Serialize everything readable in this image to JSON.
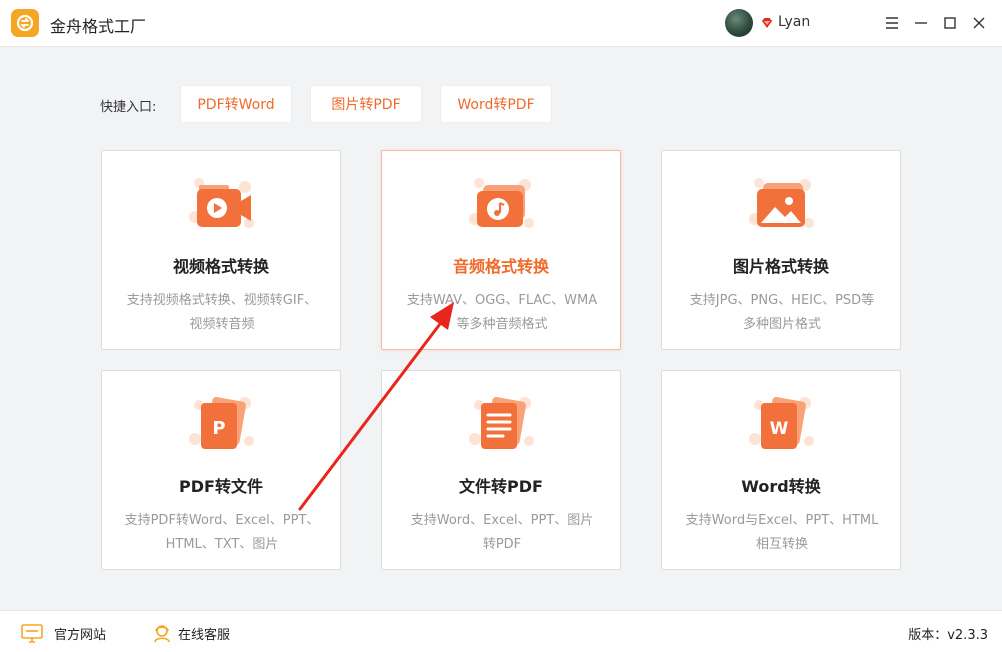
{
  "app": {
    "title": "金舟格式工厂"
  },
  "user": {
    "name": "Lyan"
  },
  "shortcuts": {
    "label": "快捷入口:",
    "items": [
      {
        "label": "PDF转Word"
      },
      {
        "label": "图片转PDF"
      },
      {
        "label": "Word转PDF"
      }
    ]
  },
  "cards": [
    {
      "title": "视频格式转换",
      "desc_line1": "支持视频格式转换、视频转GIF、",
      "desc_line2": "视频转音频",
      "icon": "video-icon"
    },
    {
      "title": "音频格式转换",
      "desc_line1": "支持WAV、OGG、FLAC、WMA",
      "desc_line2": "等多种音频格式",
      "icon": "audio-icon",
      "active": true
    },
    {
      "title": "图片格式转换",
      "desc_line1": "支持JPG、PNG、HEIC、PSD等",
      "desc_line2": "多种图片格式",
      "icon": "image-icon"
    },
    {
      "title": "PDF转文件",
      "desc_line1": "支持PDF转Word、Excel、PPT、",
      "desc_line2": "HTML、TXT、图片",
      "icon": "pdf-icon"
    },
    {
      "title": "文件转PDF",
      "desc_line1": "支持Word、Excel、PPT、图片",
      "desc_line2": "转PDF",
      "icon": "document-icon"
    },
    {
      "title": "Word转换",
      "desc_line1": "支持Word与Excel、PPT、HTML",
      "desc_line2": "相互转换",
      "icon": "word-icon"
    }
  ],
  "footer": {
    "website": "官方网站",
    "support": "在线客服",
    "version": "版本：v2.3.3"
  },
  "colors": {
    "accent": "#f06a2b",
    "annotation": "#e8261c"
  }
}
